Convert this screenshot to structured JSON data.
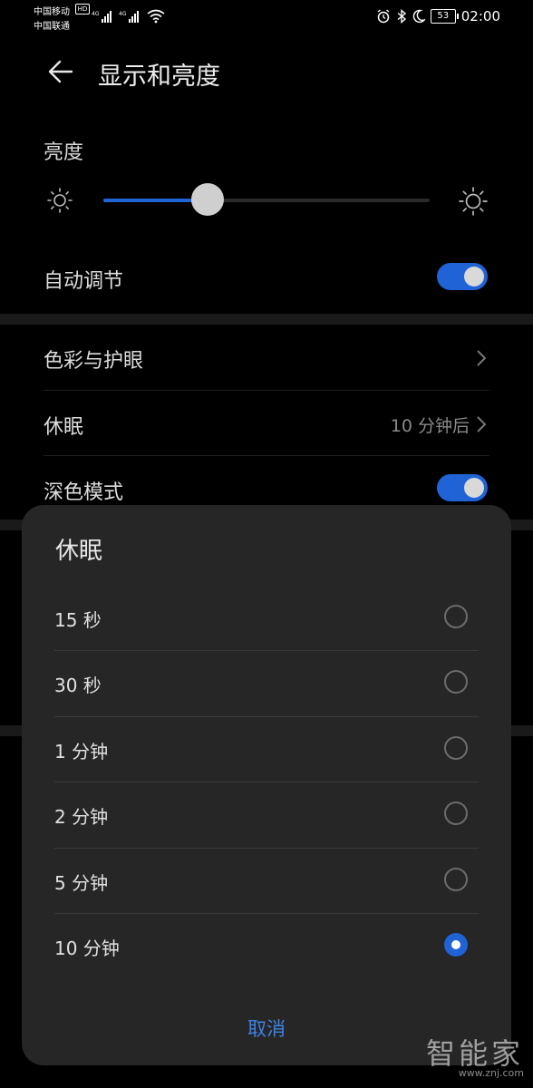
{
  "status_bar": {
    "carrier_1": "中国移动",
    "carrier_2": "中国联通",
    "hd": "HD",
    "net_1": "4G",
    "net_2": "4G",
    "battery": "53",
    "time": "02:00"
  },
  "header": {
    "title": "显示和亮度"
  },
  "brightness": {
    "label": "亮度",
    "level_percent": 32
  },
  "settings": {
    "auto_adjust": {
      "label": "自动调节",
      "on": true
    },
    "color_eye": {
      "label": "色彩与护眼"
    },
    "sleep": {
      "label": "休眠",
      "value": "10 分钟后"
    },
    "dark_mode": {
      "label": "深色模式",
      "on": true
    }
  },
  "dialog": {
    "title": "休眠",
    "options": [
      "15 秒",
      "30 秒",
      "1 分钟",
      "2 分钟",
      "5 分钟",
      "10 分钟"
    ],
    "selected_index": 5,
    "cancel_label": "取消"
  },
  "watermark": {
    "text": "智能家",
    "url": "www.znj.com"
  },
  "colors": {
    "accent": "#1f63d6",
    "link": "#3e83e8",
    "sheet": "#262626"
  }
}
